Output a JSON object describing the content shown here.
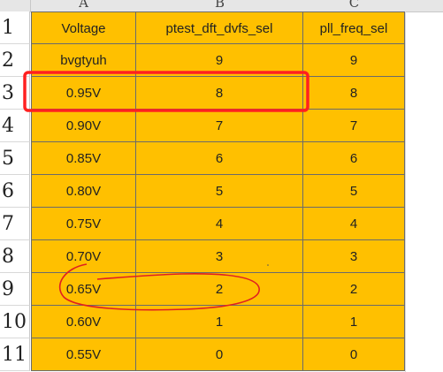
{
  "columns": [
    "A",
    "B",
    "C"
  ],
  "headers": {
    "voltage": "Voltage",
    "dvfs": "ptest_dft_dvfs_sel",
    "pll": "pll_freq_sel"
  },
  "rows": [
    {
      "num": "1"
    },
    {
      "num": "2",
      "voltage": "bvgtyuh",
      "dvfs": "9",
      "pll": "9"
    },
    {
      "num": "3",
      "voltage": "0.95V",
      "dvfs": "8",
      "pll": "8"
    },
    {
      "num": "4",
      "voltage": "0.90V",
      "dvfs": "7",
      "pll": "7"
    },
    {
      "num": "5",
      "voltage": "0.85V",
      "dvfs": "6",
      "pll": "6"
    },
    {
      "num": "6",
      "voltage": "0.80V",
      "dvfs": "5",
      "pll": "5"
    },
    {
      "num": "7",
      "voltage": "0.75V",
      "dvfs": "4",
      "pll": "4"
    },
    {
      "num": "8",
      "voltage": "0.70V",
      "dvfs": "3",
      "pll": "3"
    },
    {
      "num": "9",
      "voltage": "0.65V",
      "dvfs": "2",
      "pll": "2"
    },
    {
      "num": "10",
      "voltage": "0.60V",
      "dvfs": "1",
      "pll": "1"
    },
    {
      "num": "11",
      "voltage": "0.55V",
      "dvfs": "0",
      "pll": "0"
    }
  ],
  "colors": {
    "cell_fill": "#ffc000",
    "highlight_box": "#ff2020",
    "annotation_ellipse": "#e02020"
  }
}
